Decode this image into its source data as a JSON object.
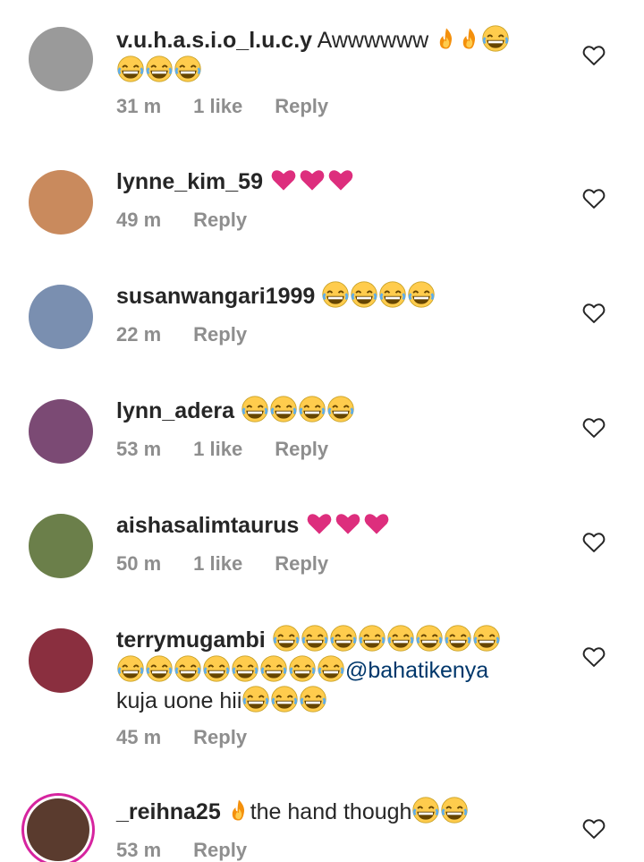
{
  "comments": [
    {
      "username": "v.u.h.a.s.i.o_l.u.c.y",
      "text": "Awwwwww",
      "emoji": [
        "fire",
        "fire",
        "laugh",
        "laugh",
        "laugh",
        "laugh"
      ],
      "time": "31 m",
      "likes": "1 like",
      "reply": "Reply",
      "avatar_color": "#9a9a9a"
    },
    {
      "username": "lynne_kim_59",
      "text": "",
      "emoji": [
        "heart",
        "heart",
        "heart"
      ],
      "time": "49 m",
      "likes": "",
      "reply": "Reply",
      "avatar_color": "#c98a5d"
    },
    {
      "username": "susanwangari1999",
      "text": "",
      "emoji": [
        "laugh",
        "laugh",
        "laugh",
        "laugh"
      ],
      "time": "22 m",
      "likes": "",
      "reply": "Reply",
      "avatar_color": "#7a8fb0"
    },
    {
      "username": "lynn_adera",
      "text": "",
      "emoji": [
        "laugh",
        "laugh",
        "laugh",
        "laugh"
      ],
      "time": "53 m",
      "likes": "1 like",
      "reply": "Reply",
      "avatar_color": "#7b4a74"
    },
    {
      "username": "aishasalimtaurus",
      "text": "",
      "emoji": [
        "heart",
        "heart",
        "heart"
      ],
      "time": "50 m",
      "likes": "1 like",
      "reply": "Reply",
      "avatar_color": "#6b7f4a"
    },
    {
      "username": "terrymugambi",
      "text_line2_mention": "@bahatikenya",
      "text_line3": "kuja uone hii",
      "emoji_line1": [
        "laugh",
        "laugh",
        "laugh",
        "laugh",
        "laugh",
        "laugh",
        "laugh",
        "laugh"
      ],
      "emoji_line2": [
        "laugh",
        "laugh",
        "laugh",
        "laugh",
        "laugh",
        "laugh",
        "laugh",
        "laugh"
      ],
      "emoji_line3": [
        "laugh",
        "laugh",
        "laugh"
      ],
      "time": "45 m",
      "likes": "",
      "reply": "Reply",
      "avatar_color": "#8a2f3f"
    },
    {
      "username": "_reihna25",
      "text": "the hand though",
      "emoji_before": [
        "fire"
      ],
      "emoji_after": [
        "laugh",
        "laugh"
      ],
      "time": "53 m",
      "likes": "",
      "reply": "Reply",
      "avatar_color": "#5a3b2e"
    }
  ],
  "icons": {
    "like": "heart-outline-icon",
    "laugh": "face-with-tears-of-joy-icon",
    "fire": "fire-icon",
    "heart": "heart-icon"
  }
}
